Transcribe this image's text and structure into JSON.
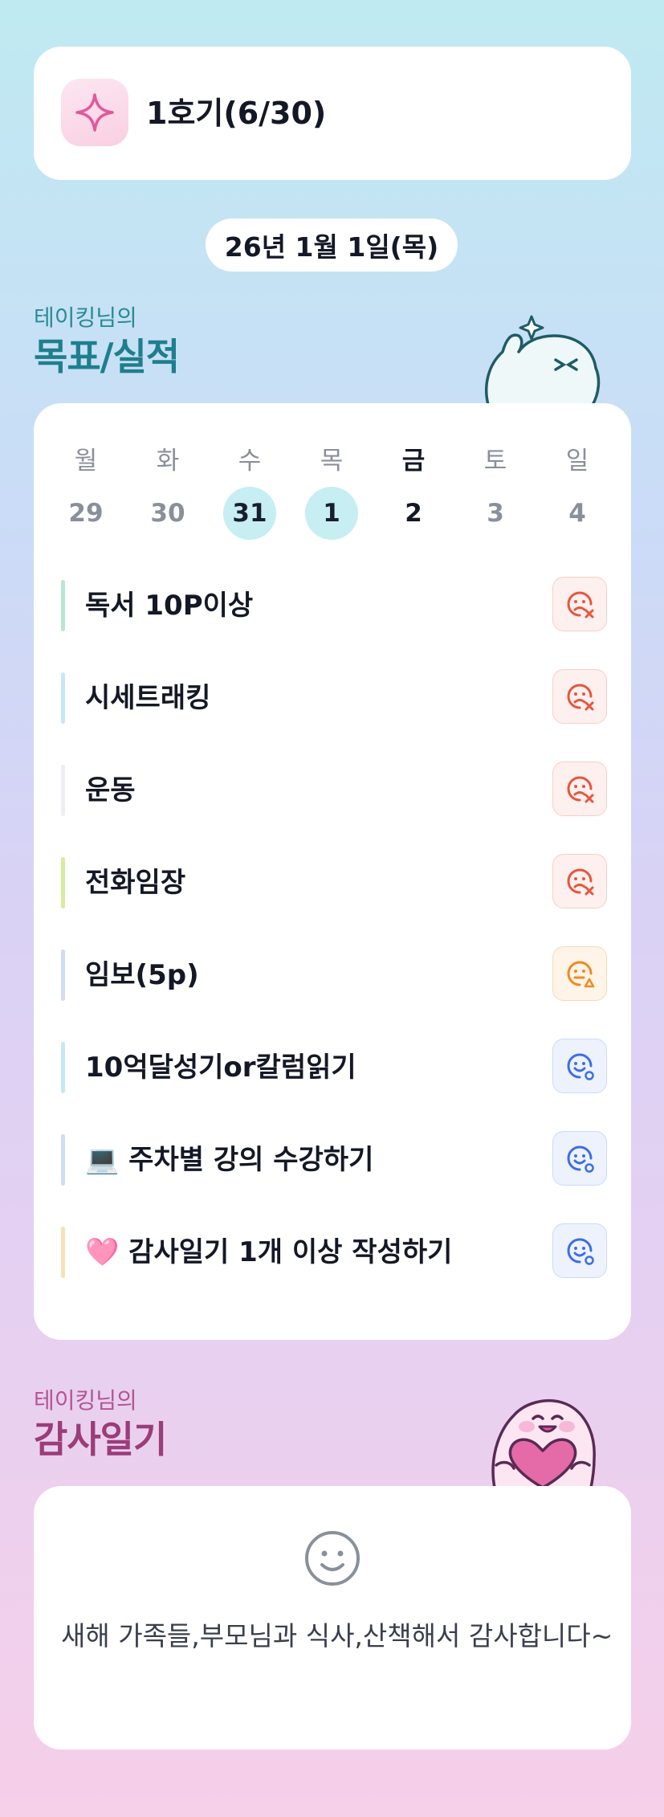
{
  "cohort": {
    "label": "1호기(6/30)",
    "icon": "sparkle-icon"
  },
  "date": "26년 1월 1일(목)",
  "goals_section": {
    "subtitle": "테이킹님의",
    "title": "목표/실적"
  },
  "week": [
    {
      "day": "월",
      "date": "29"
    },
    {
      "day": "화",
      "date": "30"
    },
    {
      "day": "수",
      "date": "31"
    },
    {
      "day": "목",
      "date": "1"
    },
    {
      "day": "금",
      "date": "2"
    },
    {
      "day": "토",
      "date": "3"
    },
    {
      "day": "일",
      "date": "4"
    }
  ],
  "goals": [
    {
      "text": "독서 10P이상",
      "bar_color": "#b9e6cf",
      "status": "fail",
      "icon": "sad-face-x-icon"
    },
    {
      "text": "시세트래킹",
      "bar_color": "#c6e8f3",
      "status": "fail",
      "icon": "sad-face-x-icon"
    },
    {
      "text": "운동",
      "bar_color": "#eeeef2",
      "status": "fail",
      "icon": "sad-face-x-icon"
    },
    {
      "text": "전화임장",
      "bar_color": "#d6ec9e",
      "status": "fail",
      "icon": "sad-face-x-icon"
    },
    {
      "text": "임보(5p)",
      "bar_color": "#cfdcf2",
      "status": "partial",
      "icon": "neutral-face-triangle-icon"
    },
    {
      "text": "10억달성기or칼럼읽기",
      "bar_color": "#c6e8f3",
      "status": "success",
      "icon": "smile-face-circle-icon"
    },
    {
      "text": "💻 주차별 강의 수강하기",
      "bar_color": "#cfdcf2",
      "status": "success",
      "icon": "smile-face-circle-icon"
    },
    {
      "text": "🩷 감사일기 1개 이상 작성하기",
      "bar_color": "#f7e2b6",
      "status": "success",
      "icon": "smile-face-circle-icon"
    }
  ],
  "gratitude_section": {
    "subtitle": "테이킹님의",
    "title": "감사일기"
  },
  "gratitude_entry": {
    "icon": "smile-face-icon",
    "text": "새해 가족들,부모님과 식사,산책해서 감사합니다~"
  },
  "colors": {
    "fail": "#e8553e",
    "partial": "#f08a1e",
    "success": "#3d6ee6",
    "highlight": "#c7eef2",
    "goals_title": "#1e7f8c",
    "gratitude_title": "#9a3d79"
  }
}
